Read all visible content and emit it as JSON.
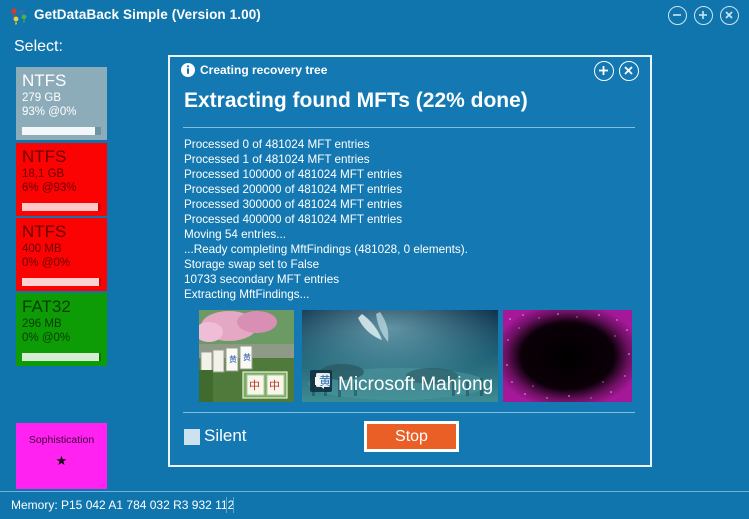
{
  "window": {
    "title": "GetDataBack Simple (Version 1.00)",
    "app_icon": "pushpins-icon",
    "controls": [
      {
        "name": "minimize-button",
        "glyph": "minus"
      },
      {
        "name": "maximize-button",
        "glyph": "plus"
      },
      {
        "name": "close-button",
        "glyph": "cross"
      }
    ]
  },
  "sidebar": {
    "label": "Select:",
    "tiles": [
      {
        "fs": "NTFS",
        "size": "279 GB",
        "percent": "93% @0%",
        "bar_fill": 93,
        "color": "#8cacba",
        "selected": true
      },
      {
        "fs": "NTFS",
        "size": "18,1 GB",
        "percent": "6% @93%",
        "bar_fill": 96,
        "color": "#fb0303",
        "selected": false
      },
      {
        "fs": "NTFS",
        "size": "400 MB",
        "percent": "0% @0%",
        "bar_fill": 97,
        "color": "#fb0303",
        "selected": false
      },
      {
        "fs": "FAT32",
        "size": "296 MB",
        "percent": "0% @0%",
        "bar_fill": 98,
        "color": "#0d9c05",
        "selected": false
      }
    ],
    "extra_tile": {
      "label": "Sophistication",
      "star": "★",
      "color": "#ff22f0"
    }
  },
  "dialog": {
    "header_title": "Creating recovery tree",
    "header_icon": "info-icon",
    "expand_button": "expand-button",
    "close_button": "close-button",
    "heading": "Extracting found MFTs (22% done)",
    "log_lines": [
      "Processed 0 of 481024 MFT entries",
      "Processed 1 of 481024 MFT entries",
      "Processed 100000 of 481024 MFT entries",
      "Processed 200000 of 481024 MFT entries",
      "Processed 300000 of 481024 MFT entries",
      "Processed 400000 of 481024 MFT entries",
      "Moving 54 entries...",
      "...Ready completing MftFindings (481028, 0 elements).",
      "Storage swap set to False",
      "10733 secondary MFT entries",
      "Extracting MftFindings..."
    ],
    "thumbnails": [
      {
        "name": "thumbnail-mahjong-garden",
        "caption": ""
      },
      {
        "name": "thumbnail-microsoft-mahjong",
        "caption": "Microsoft Mahjong"
      },
      {
        "name": "thumbnail-dark-purple",
        "caption": ""
      }
    ],
    "silent_checkbox": {
      "label": "Silent",
      "checked": false
    },
    "stop_button": "Stop"
  },
  "statusbar": {
    "text": "Memory: P15 042 A1 784 032 R3 932 112"
  },
  "colors": {
    "window_bg": "#1175ad",
    "dialog_bg": "#1479b3",
    "accent_orange": "#ea5f26",
    "tile_selected": "#8cacba",
    "tile_red": "#fb0303",
    "tile_green": "#0d9c05",
    "tile_magenta": "#ff22f0"
  }
}
